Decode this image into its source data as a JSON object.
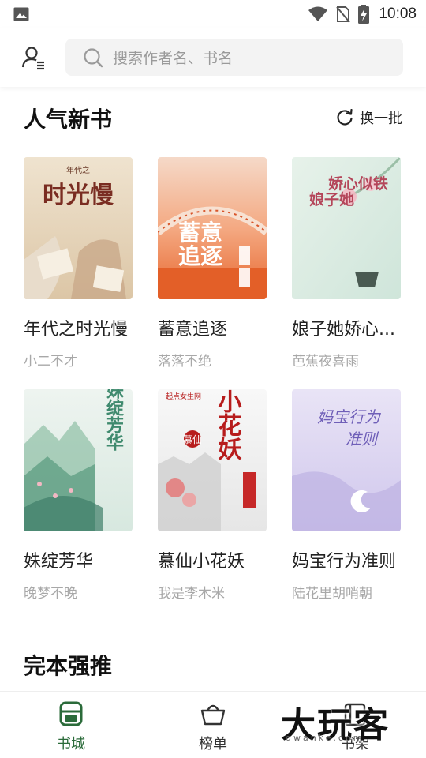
{
  "status_bar": {
    "time": "10:08"
  },
  "search": {
    "placeholder": "搜索作者名、书名"
  },
  "section_popular": {
    "title": "人气新书",
    "refresh_label": "换一批"
  },
  "books": [
    {
      "title": "年代之时光慢",
      "author": "小二不才",
      "cover_text": [
        "时光慢",
        "年代之"
      ]
    },
    {
      "title": "蓄意追逐",
      "author": "落落不绝",
      "cover_text": [
        "蓄意",
        "追逐"
      ]
    },
    {
      "title": "娘子她娇心...",
      "author": "芭蕉夜喜雨",
      "cover_text": [
        "娘子她",
        "娇心似铁"
      ]
    },
    {
      "title": "姝绽芳华",
      "author": "晚梦不晚",
      "cover_text": [
        "姝绽芳华"
      ]
    },
    {
      "title": "慕仙小花妖",
      "author": "我是李木米",
      "cover_text": [
        "小花妖",
        "慕仙",
        "起点女生网"
      ]
    },
    {
      "title": "妈宝行为准则",
      "author": "陆花里胡哨朝",
      "cover_text": [
        "妈宝行为",
        "准则"
      ]
    }
  ],
  "section_complete": {
    "title": "完本强推"
  },
  "bottom_nav": [
    {
      "label": "书城",
      "icon": "bookstore-icon",
      "active": true
    },
    {
      "label": "榜单",
      "icon": "ranking-basket-icon",
      "active": false
    },
    {
      "label": "书架",
      "icon": "bookshelf-icon",
      "active": false
    }
  ],
  "watermark": {
    "text": "大玩客",
    "sub": "dwanke.com"
  },
  "colors": {
    "accent": "#2b6b3a",
    "muted": "#a8a8a8",
    "search_bg": "#f3f3f3"
  }
}
